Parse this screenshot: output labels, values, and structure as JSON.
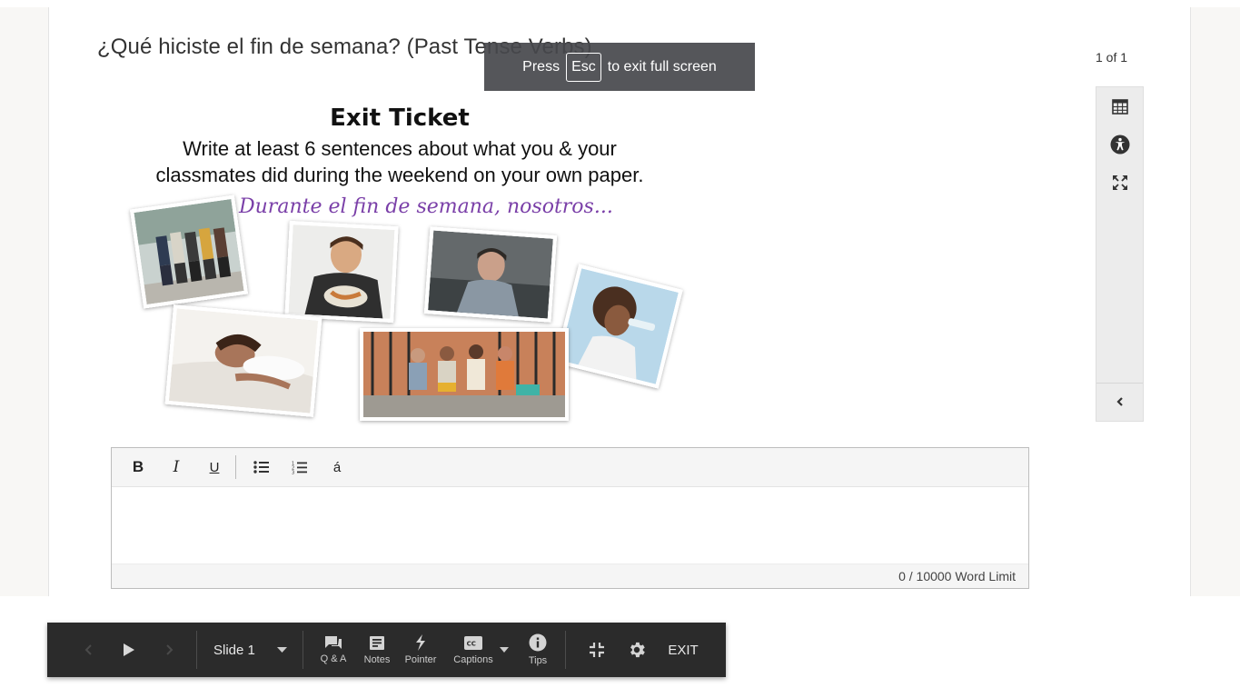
{
  "page": {
    "title": "¿Qué hiciste el fin de semana? (Past Tense Verbs)"
  },
  "fullscreen_notice": {
    "prefix": "Press",
    "key": "Esc",
    "suffix": "to exit full screen"
  },
  "pager": {
    "counter": "1 of 1"
  },
  "side_tools": [
    {
      "name": "calendar-icon"
    },
    {
      "name": "accessibility-icon"
    },
    {
      "name": "expand-icon"
    },
    {
      "name": "chevron-left-icon"
    }
  ],
  "slide": {
    "heading": "Exit Ticket",
    "line1": "Write at least 6 sentences about what you & your",
    "line2": "classmates did during the weekend on your own paper.",
    "prompt": "Durante el fin de semana, nosotros..."
  },
  "editor": {
    "buttons": {
      "bold": "B",
      "italic": "I",
      "underline": "U",
      "accent": "á"
    },
    "value": "",
    "word_count": "0",
    "word_limit_text": "/ 10000 Word Limit"
  },
  "control_bar": {
    "slide_select": "Slide 1",
    "qa_label": "Q & A",
    "notes_label": "Notes",
    "pointer_label": "Pointer",
    "captions_label": "Captions",
    "tips_label": "Tips",
    "exit_label": "EXIT"
  }
}
